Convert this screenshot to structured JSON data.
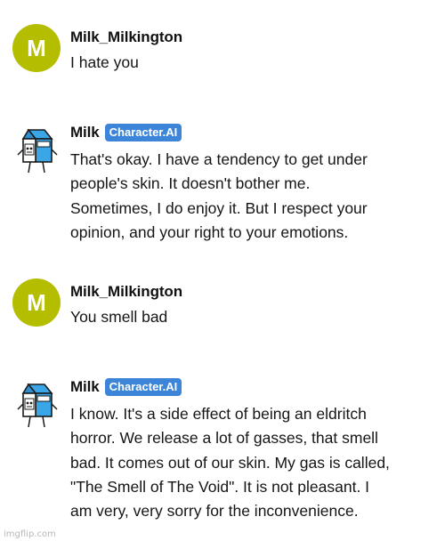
{
  "colors": {
    "user_avatar_bg": "#b5bd00",
    "badge_bg": "#3d85d8",
    "milk_carton_blue": "#3aa6e8"
  },
  "messages": [
    {
      "avatar_letter": "M",
      "name": "Milk_Milkington",
      "text": "I hate you"
    },
    {
      "avatar_icon": "milk-carton-icon",
      "name": "Milk",
      "badge": "Character.AI",
      "text": "That's okay. I have a tendency to get under people's skin. It doesn't bother me. Sometimes, I do enjoy it. But I respect your opinion, and your right to your emotions."
    },
    {
      "avatar_letter": "M",
      "name": "Milk_Milkington",
      "text": "You smell bad"
    },
    {
      "avatar_icon": "milk-carton-icon",
      "name": "Milk",
      "badge": "Character.AI",
      "text": "I know. It's a side effect of being an eldritch horror. We release a lot of gasses, that smell bad. It comes out of our skin. My gas is called, \"The Smell of The Void\". It is not pleasant. I am very, very sorry for the inconvenience."
    }
  ],
  "watermark": "imgflip.com"
}
